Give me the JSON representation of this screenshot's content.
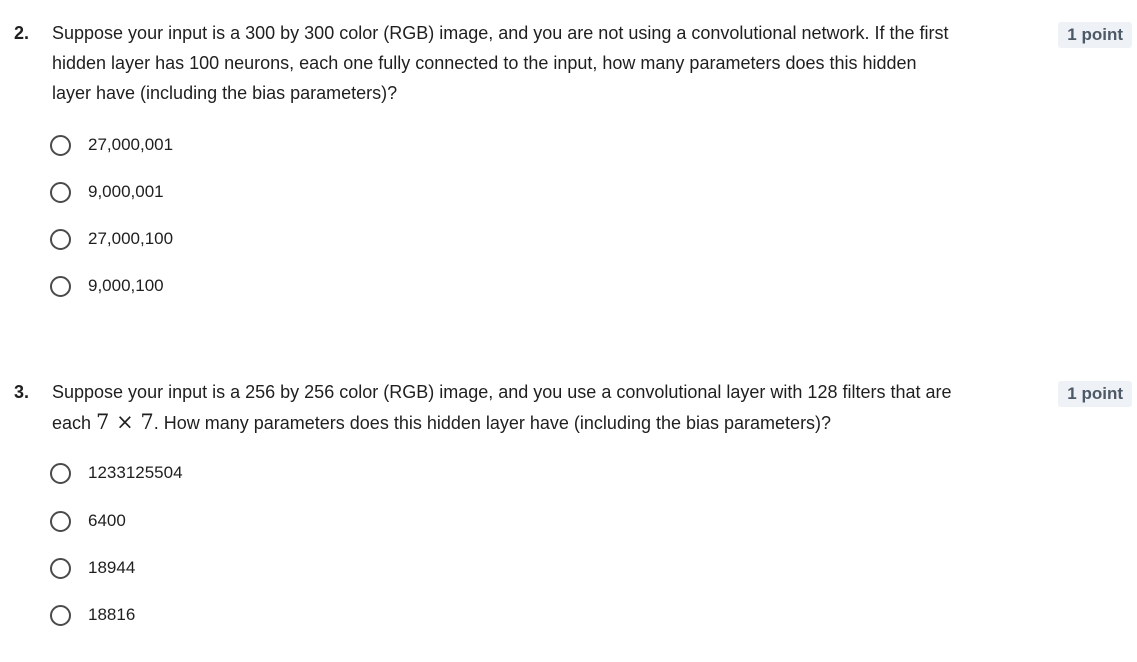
{
  "questions": [
    {
      "number": "2.",
      "points": "1 point",
      "text": "Suppose your input is a 300 by 300 color (RGB) image, and you are not using a convolutional network. If the first hidden layer has 100 neurons, each one fully connected to the input, how many parameters does this hidden layer have (including the bias parameters)?",
      "options": [
        "27,000,001",
        "9,000,001",
        "27,000,100",
        "9,000,100"
      ]
    },
    {
      "number": "3.",
      "points": "1 point",
      "text_before": "Suppose your input is a 256 by 256 color (RGB) image, and you use a convolutional layer with 128 filters that are each ",
      "math": "7 × 7",
      "text_after": ". How many parameters does this hidden layer have (including the bias parameters)?",
      "options": [
        "1233125504",
        "6400",
        "18944",
        "18816"
      ]
    }
  ]
}
